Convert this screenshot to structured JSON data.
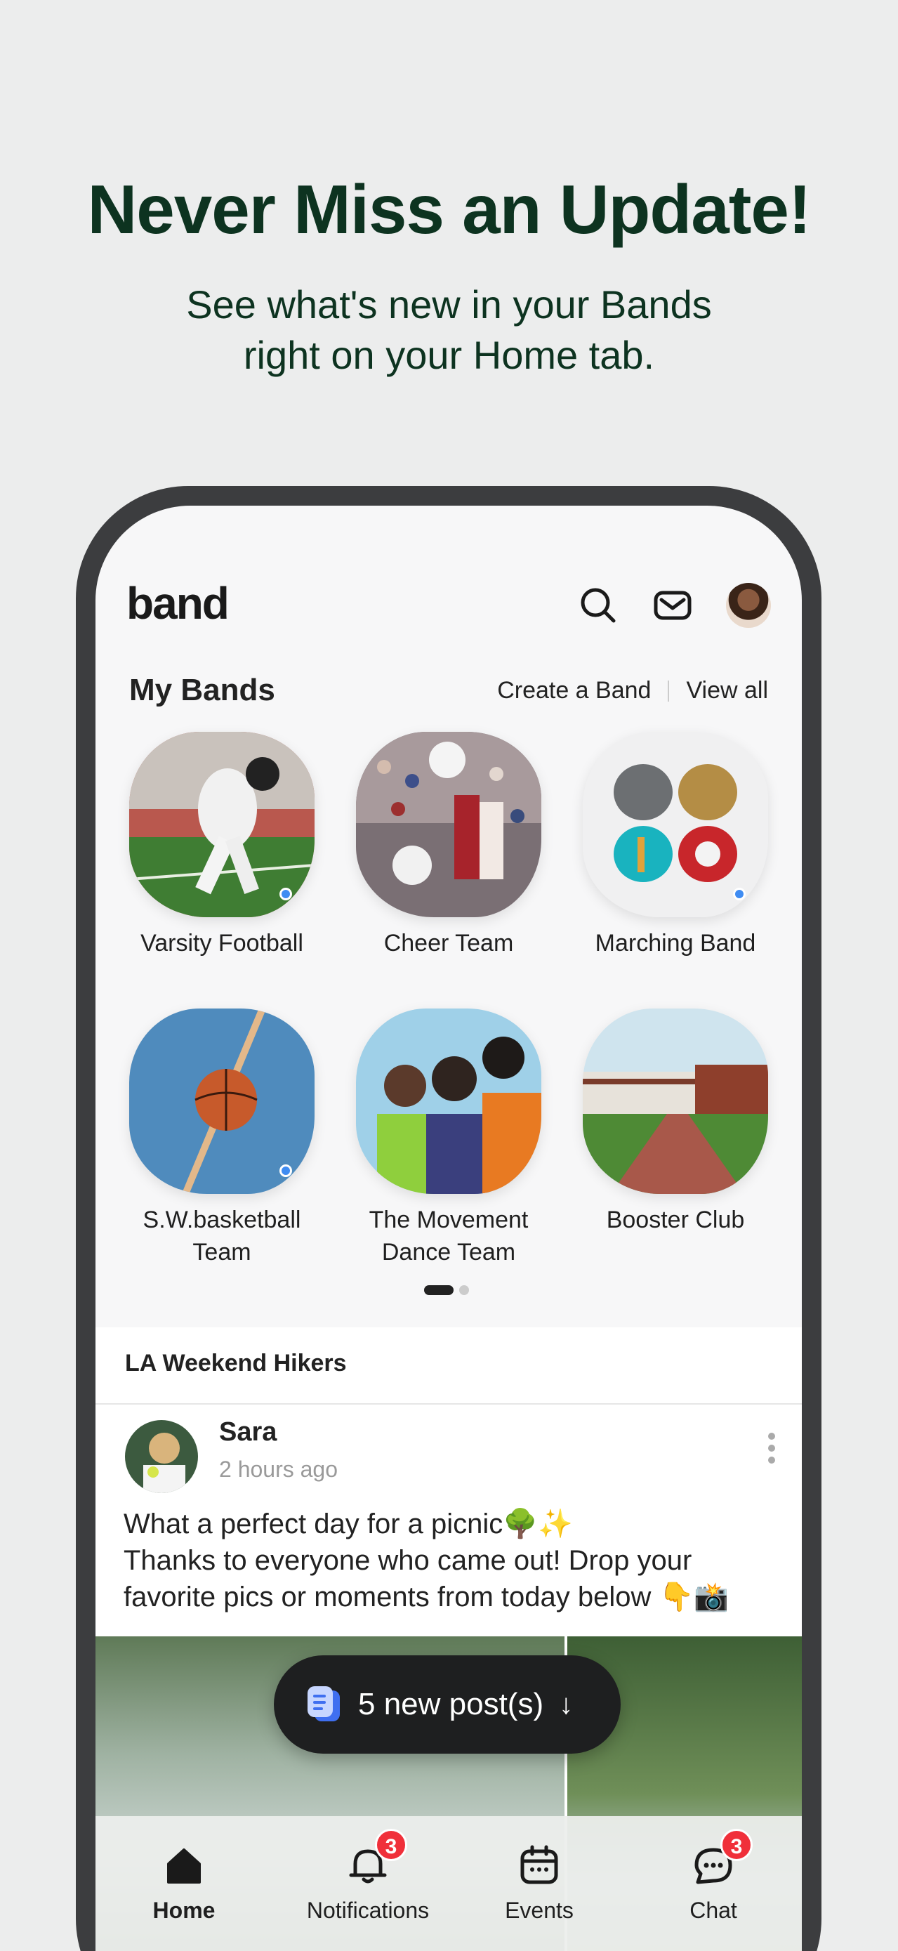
{
  "promo": {
    "headline": "Never Miss an Update!",
    "subhead_line1": "See what's new in your Bands",
    "subhead_line2": "right on your Home tab."
  },
  "app": {
    "logo": "band",
    "icons": [
      "search-icon",
      "mail-icon",
      "profile-avatar"
    ]
  },
  "my_bands": {
    "title": "My Bands",
    "create_label": "Create a Band",
    "view_all_label": "View all",
    "bands": [
      {
        "line1": "Varsity Football",
        "line2": "",
        "has_update": true
      },
      {
        "line1": "Cheer Team",
        "line2": "",
        "has_update": false
      },
      {
        "line1": "Marching Band",
        "line2": "",
        "has_update": true
      },
      {
        "line1": "S.W.basketball",
        "line2": "Team",
        "has_update": true
      },
      {
        "line1": "The Movement",
        "line2": "Dance Team",
        "has_update": false
      },
      {
        "line1": "Booster Club",
        "line2": "",
        "has_update": false
      }
    ],
    "page_indicator": {
      "current": 1,
      "total": 2
    }
  },
  "feed": {
    "group_name": "LA Weekend Hikers",
    "post": {
      "author": "Sara",
      "time": "2 hours ago",
      "body_line1": "What a perfect day for a picnic🌳✨",
      "body_line2": "Thanks to everyone who came out! Drop your",
      "body_line3": "favorite pics or moments from today below 👇📸"
    }
  },
  "new_posts": {
    "label": "5 new post(s)",
    "arrow": "↓"
  },
  "tabbar": {
    "tabs": [
      {
        "label": "Home",
        "icon": "home-icon",
        "badge": ""
      },
      {
        "label": "Notifications",
        "icon": "bell-icon",
        "badge": "3"
      },
      {
        "label": "Events",
        "icon": "calendar-icon",
        "badge": ""
      },
      {
        "label": "Chat",
        "icon": "chat-icon",
        "badge": "3"
      }
    ]
  },
  "colors": {
    "headline": "#0d3320",
    "update_dot": "#3f8cf2",
    "badge": "#f0303a"
  }
}
